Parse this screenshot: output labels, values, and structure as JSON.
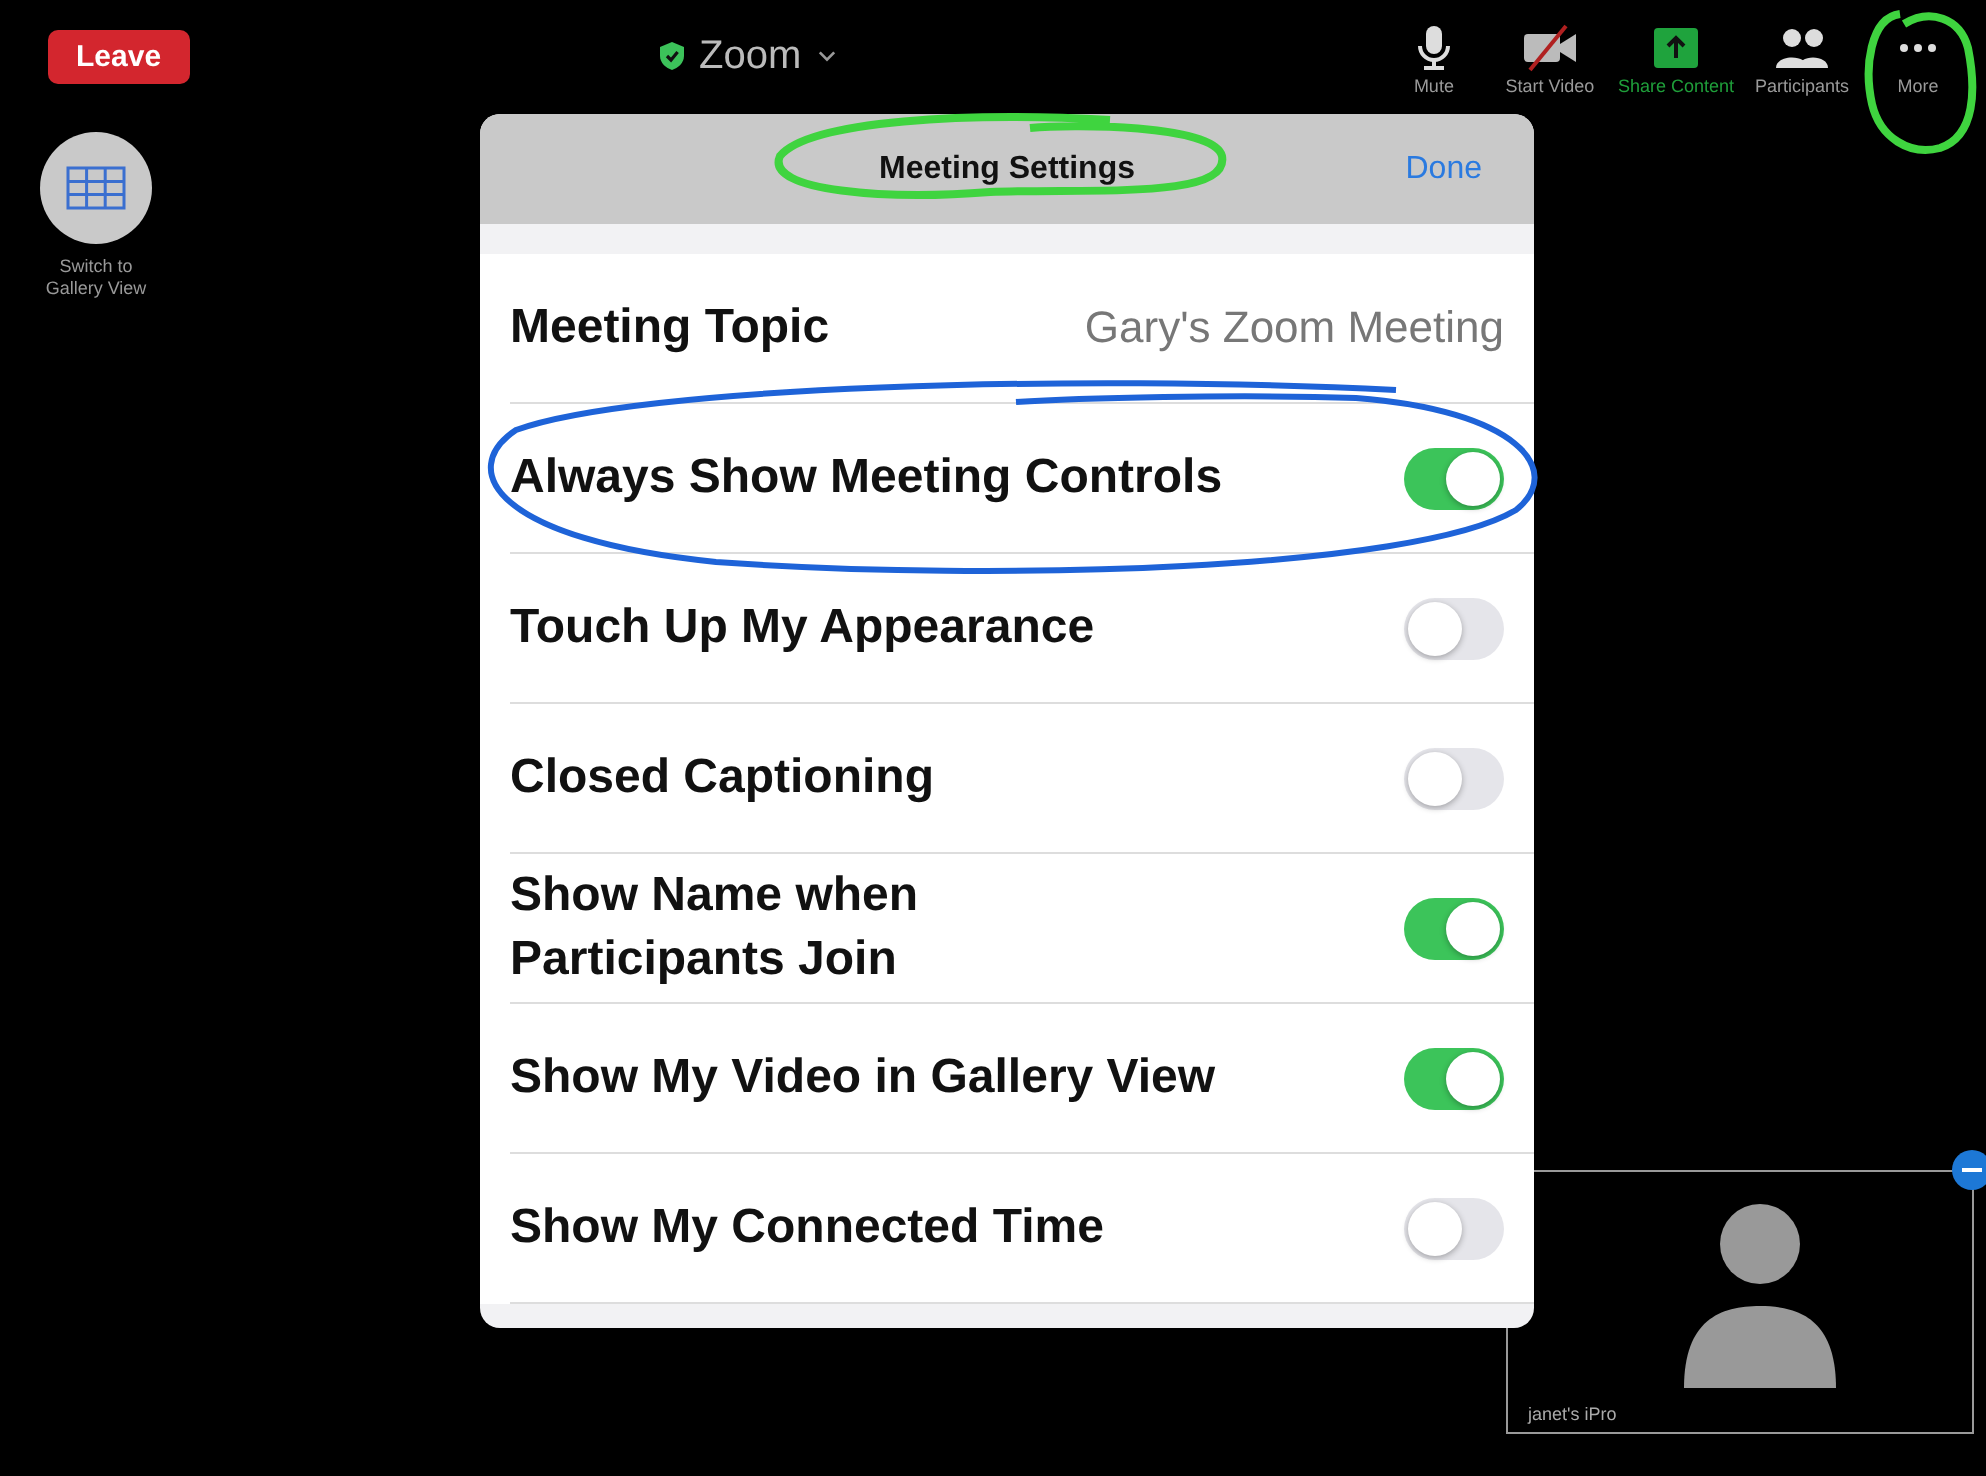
{
  "top_bar": {
    "leave_button": "Leave",
    "meeting_title": "Zoom",
    "toolbar": [
      {
        "label": "Mute",
        "kind": "mic"
      },
      {
        "label": "Start Video",
        "kind": "video_off"
      },
      {
        "label": "Share Content",
        "kind": "share"
      },
      {
        "label": "Participants",
        "kind": "participants"
      },
      {
        "label": "More",
        "kind": "more"
      }
    ]
  },
  "gallery_button": {
    "label": "Switch to Gallery View"
  },
  "settings": {
    "title": "Meeting Settings",
    "done": "Done",
    "topic": {
      "label": "Meeting Topic",
      "value": "Gary's Zoom Meeting"
    },
    "toggles": [
      {
        "label": "Always Show Meeting Controls",
        "on": true
      },
      {
        "label": "Touch Up My Appearance",
        "on": false
      },
      {
        "label": "Closed Captioning",
        "on": false
      },
      {
        "label": "Show Name when Participants Join",
        "on": true
      },
      {
        "label": "Show My Video in Gallery View",
        "on": true
      },
      {
        "label": "Show My Connected Time",
        "on": false
      }
    ]
  },
  "self_view": {
    "name": "janet's iPro"
  }
}
